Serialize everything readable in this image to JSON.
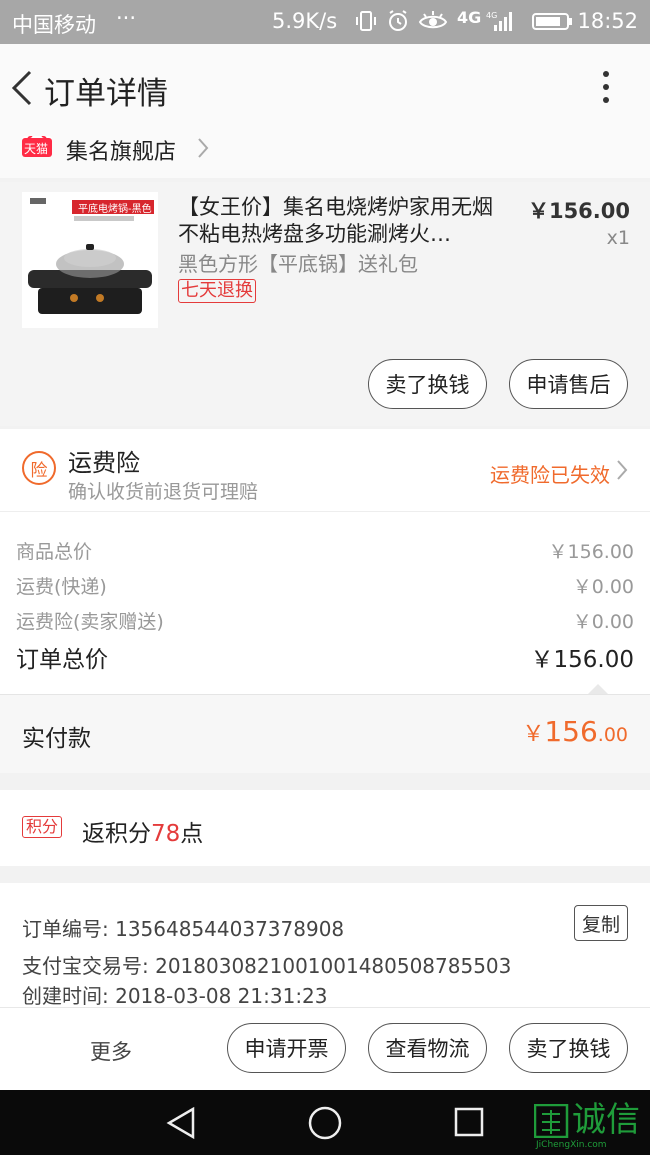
{
  "status_bar": {
    "carrier": "中国移动",
    "dots": "···",
    "speed": "5.9K/s",
    "network": "4G",
    "time": "18:52"
  },
  "header": {
    "title": "订单详情"
  },
  "shop": {
    "badge": "天猫",
    "name": "集名旗舰店"
  },
  "product": {
    "thumb_banner": "平底电烤锅-黑色",
    "title": "【女王价】集名电烧烤炉家用无烟不粘电热烤盘多功能涮烤火…",
    "sku": "黑色方形【平底锅】送礼包",
    "return_tag": "七天退换",
    "price": "￥156.00",
    "quantity": "x1",
    "buttons": [
      "卖了换钱",
      "申请售后"
    ]
  },
  "insurance": {
    "icon_label": "险",
    "title": "运费险",
    "subtitle": "确认收货前退货可理赔",
    "status": "运费险已失效"
  },
  "price_breakdown": [
    {
      "label": "商品总价",
      "value": "￥156.00"
    },
    {
      "label": "运费(快递)",
      "value": "￥0.00"
    },
    {
      "label": "运费险(卖家赠送)",
      "value": "￥0.00"
    },
    {
      "label": "订单总价",
      "value": "￥156.00"
    }
  ],
  "payment": {
    "label": "实付款",
    "currency": "￥",
    "integer": "156",
    "decimal": ".00"
  },
  "points": {
    "badge": "积分",
    "prefix": "返积分",
    "amount": "78",
    "suffix": "点"
  },
  "order_info": {
    "order_no": "订单编号: 135648544037378908",
    "alipay_no": "支付宝交易号: 2018030821001001480508785503",
    "created": "创建时间: 2018-03-08 21:31:23",
    "copy_label": "复制"
  },
  "bottom_bar": {
    "more": "更多",
    "buttons": [
      "申请开票",
      "查看物流",
      "卖了换钱"
    ]
  },
  "watermark": {
    "cn": "诚信",
    "url": "JiChengXin.com"
  },
  "colors": {
    "accent": "#f06a2c",
    "red": "#e43b3b",
    "watermark_green": "#1f9c3a"
  }
}
